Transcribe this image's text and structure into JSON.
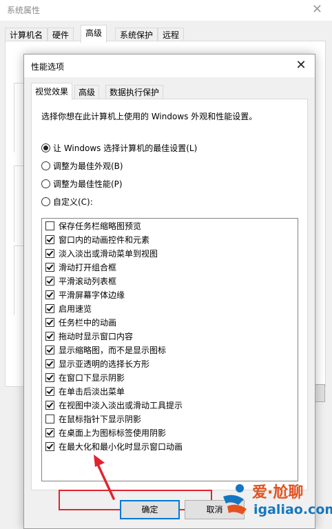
{
  "background_window": {
    "title": "系统属性",
    "tabs": [
      "计算机名",
      "硬件",
      "高级",
      "系统保护",
      "远程"
    ],
    "active_tab": 2
  },
  "dialog": {
    "title": "性能选项",
    "tabs": [
      "视觉效果",
      "高级",
      "数据执行保护"
    ],
    "active_tab": 0,
    "description": "选择你想在此计算机上使用的 Windows 外观和性能设置。",
    "radios": [
      {
        "label": "让 Windows 选择计算机的最佳设置(L)",
        "checked": true
      },
      {
        "label": "调整为最佳外观(B)",
        "checked": false
      },
      {
        "label": "调整为最佳性能(P)",
        "checked": false
      },
      {
        "label": "自定义(C):",
        "checked": false
      }
    ],
    "options": [
      {
        "label": "保存任务栏缩略图预览",
        "checked": false
      },
      {
        "label": "窗口内的动画控件和元素",
        "checked": true
      },
      {
        "label": "淡入淡出或滑动菜单到视图",
        "checked": true
      },
      {
        "label": "滑动打开组合框",
        "checked": true
      },
      {
        "label": "平滑滚动列表框",
        "checked": true
      },
      {
        "label": "平滑屏幕字体边缘",
        "checked": true
      },
      {
        "label": "启用速览",
        "checked": true
      },
      {
        "label": "任务栏中的动画",
        "checked": true
      },
      {
        "label": "拖动时显示窗口内容",
        "checked": true
      },
      {
        "label": "显示缩略图，而不是显示图标",
        "checked": true
      },
      {
        "label": "显示亚透明的选择长方形",
        "checked": true
      },
      {
        "label": "在窗口下显示阴影",
        "checked": true
      },
      {
        "label": "在单击后淡出菜单",
        "checked": true
      },
      {
        "label": "在视图中淡入淡出或滑动工具提示",
        "checked": true
      },
      {
        "label": "在鼠标指针下显示阴影",
        "checked": false
      },
      {
        "label": "在桌面上为图标标签使用阴影",
        "checked": true
      },
      {
        "label": "在最大化和最小化时显示窗口动画",
        "checked": true
      }
    ],
    "highlighted_option_index": 16,
    "buttons": {
      "ok": "确定",
      "cancel": "取消"
    }
  },
  "annotation": {
    "color": "#e0242e"
  },
  "watermark": {
    "text_cn": "爱·尬聊",
    "text_en": "igaliao.com"
  }
}
